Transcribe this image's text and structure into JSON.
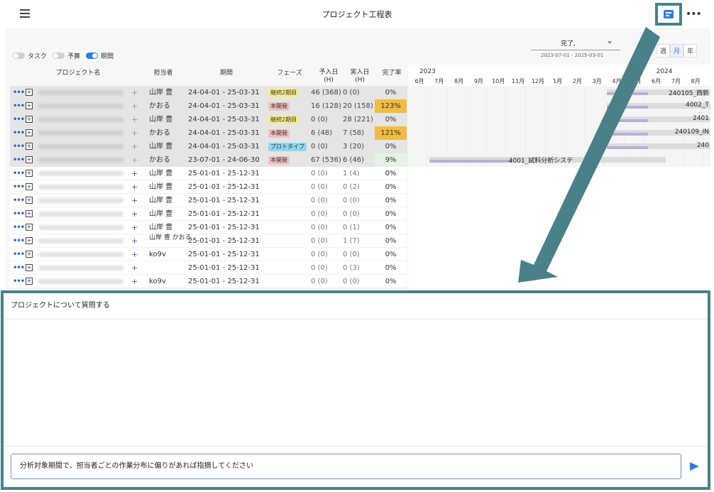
{
  "header": {
    "title": "プロジェクト工程表",
    "more_label": "•••"
  },
  "toggles": [
    {
      "label": "タスク",
      "on": false
    },
    {
      "label": "予算",
      "on": false
    },
    {
      "label": "期間",
      "on": true
    }
  ],
  "filter": {
    "selected": "完了,",
    "range": "2023-07-01 - 2025-03-01"
  },
  "scale_buttons": [
    {
      "label": "週",
      "selected": false
    },
    {
      "label": "月",
      "selected": true
    },
    {
      "label": "年",
      "selected": false
    }
  ],
  "table": {
    "headers": {
      "project": "プロジェクト名",
      "owner": "担当者",
      "period": "期間",
      "phase": "フェーズ",
      "plan": "予入日\n(H)",
      "actual": "実入日\n(H)",
      "done": "完了率"
    },
    "rows": [
      {
        "owner": "山岸 豊",
        "period": "24-04-01 - 25-03-31",
        "phase": "継続2期目",
        "phase_color": "#f7ec8a",
        "plan": "46 (368)",
        "actual": "0 (0)",
        "pct": "0%",
        "pct_bg": "",
        "dark": true
      },
      {
        "owner": "かおる",
        "period": "24-04-01 - 25-03-31",
        "phase": "本開発",
        "phase_color": "#f3c1bf",
        "plan": "16 (128)",
        "actual": "20 (158)",
        "pct": "123%",
        "pct_bg": "#f2bc43",
        "dark": true
      },
      {
        "owner": "山岸 豊",
        "period": "24-04-01 - 25-03-31",
        "phase": "継続2期目",
        "phase_color": "#f7ec8a",
        "plan": "0 (0)",
        "actual": "28 (221)",
        "pct": "0%",
        "pct_bg": "",
        "dark": true
      },
      {
        "owner": "かおる",
        "period": "24-04-01 - 25-03-31",
        "phase": "本開発",
        "phase_color": "#f3c1bf",
        "plan": "6 (48)",
        "actual": "7 (58)",
        "pct": "121%",
        "pct_bg": "#f2bc43",
        "dark": true
      },
      {
        "owner": "山岸 豊",
        "period": "24-04-01 - 25-03-31",
        "phase": "プロトタイプ",
        "phase_color": "#8fd8f0",
        "plan": "0 (0)",
        "actual": "3 (20)",
        "pct": "0%",
        "pct_bg": "",
        "dark": true
      },
      {
        "owner": "かおる",
        "period": "23-07-01 - 24-06-30",
        "phase": "本開発",
        "phase_color": "#f3c1bf",
        "plan": "67 (536)",
        "actual": "6 (46)",
        "pct": "9%",
        "pct_bg": "#e4f3e4",
        "dark": true
      },
      {
        "owner": "山岸 豊",
        "period": "25-01-01 - 25-12-31",
        "phase": "",
        "phase_color": "",
        "plan": "0 (0)",
        "actual": "1 (4)",
        "pct": "0%",
        "pct_bg": "",
        "dark": false
      },
      {
        "owner": "山岸 豊",
        "period": "25-01-01 - 25-12-31",
        "phase": "",
        "phase_color": "",
        "plan": "0 (0)",
        "actual": "0 (2)",
        "pct": "0%",
        "pct_bg": "",
        "dark": false
      },
      {
        "owner": "山岸 豊",
        "period": "25-01-01 - 25-12-31",
        "phase": "",
        "phase_color": "",
        "plan": "0 (0)",
        "actual": "0 (0)",
        "pct": "0%",
        "pct_bg": "",
        "dark": false
      },
      {
        "owner": "山岸 豊",
        "period": "25-01-01 - 25-12-31",
        "phase": "",
        "phase_color": "",
        "plan": "0 (0)",
        "actual": "0 (0)",
        "pct": "0%",
        "pct_bg": "",
        "dark": false
      },
      {
        "owner": "山岸 豊",
        "period": "25-01-01 - 25-12-31",
        "phase": "",
        "phase_color": "",
        "plan": "0 (0)",
        "actual": "0 (1)",
        "pct": "0%",
        "pct_bg": "",
        "dark": false
      },
      {
        "owner": "山岸 豊 かおる",
        "period": "25-01-01 - 25-12-31",
        "phase": "",
        "phase_color": "",
        "plan": "0 (0)",
        "actual": "1 (7)",
        "pct": "0%",
        "pct_bg": "",
        "dark": false
      },
      {
        "owner": "ko9v",
        "period": "25-01-01 - 25-12-31",
        "phase": "",
        "phase_color": "",
        "plan": "0 (0)",
        "actual": "0 (0)",
        "pct": "0%",
        "pct_bg": "",
        "dark": false
      },
      {
        "owner": "",
        "period": "25-01-01 - 25-12-31",
        "phase": "",
        "phase_color": "",
        "plan": "0 (0)",
        "actual": "0 (3)",
        "pct": "0%",
        "pct_bg": "",
        "dark": false
      },
      {
        "owner": "ko9v",
        "period": "25-01-01 - 25-12-31",
        "phase": "",
        "phase_color": "",
        "plan": "0 (0)",
        "actual": "0 (0)",
        "pct": "0%",
        "pct_bg": "",
        "dark": false
      }
    ]
  },
  "gantt": {
    "years": [
      {
        "label": "2023",
        "month_index": 0
      },
      {
        "label": "2024",
        "month_index": 12
      }
    ],
    "months": [
      "6月",
      "7月",
      "8月",
      "9月",
      "10月",
      "11月",
      "12月",
      "1月",
      "2月",
      "3月",
      "4月",
      "5月",
      "6月",
      "7月",
      "8月"
    ],
    "bars": [
      {
        "row": 0,
        "start": 10,
        "end": 16,
        "label": "240105_西新"
      },
      {
        "row": 1,
        "start": 10,
        "end": 16,
        "label": "4002_T"
      },
      {
        "row": 2,
        "start": 10,
        "end": 16,
        "label": "2401"
      },
      {
        "row": 3,
        "start": 10,
        "end": 16,
        "label": "240109_IN"
      },
      {
        "row": 4,
        "start": 10,
        "end": 16,
        "label": "240"
      },
      {
        "row": 5,
        "start": 1,
        "end": 13,
        "label": "4001_試料分析システ"
      }
    ]
  },
  "chat": {
    "heading": "プロジェクトについて質問する",
    "input_value": "分析対象期間で、担当者ごとの作業分布に偏りがあれば指摘してください"
  }
}
